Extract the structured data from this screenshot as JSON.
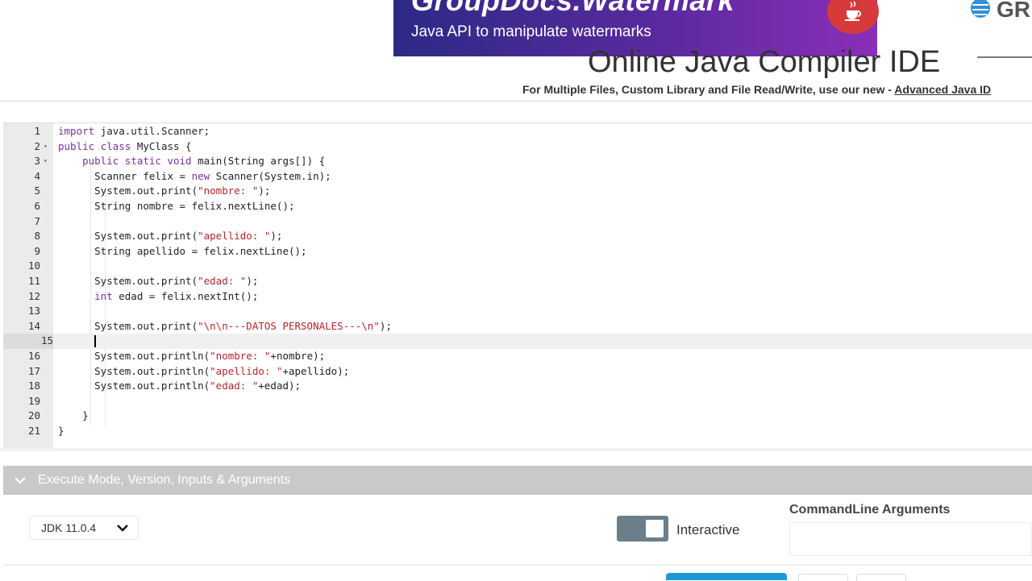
{
  "banner": {
    "title": "GroupDocs.Watermark",
    "subtitle": "Java API to manipulate watermarks",
    "icon": "java-cup-icon"
  },
  "brand_corner": {
    "text": "GR",
    "icon": "groupdocs-logo-icon"
  },
  "header": {
    "title": "Online Java Compiler IDE",
    "subtitle_prefix": "For Multiple Files, Custom Library and File Read/Write, use our new - ",
    "subtitle_link": "Advanced Java ID"
  },
  "editor": {
    "active_line": 15,
    "lines": [
      {
        "n": "1",
        "code": "import java.util.Scanner;"
      },
      {
        "n": "2",
        "code": "public class MyClass {"
      },
      {
        "n": "3",
        "code": "    public static void main(String args[]) {"
      },
      {
        "n": "4",
        "code": "      Scanner felix = new Scanner(System.in);"
      },
      {
        "n": "5",
        "code": "      System.out.print(\"nombre: \");"
      },
      {
        "n": "6",
        "code": "      String nombre = felix.nextLine();"
      },
      {
        "n": "7",
        "code": ""
      },
      {
        "n": "8",
        "code": "      System.out.print(\"apellido: \");"
      },
      {
        "n": "9",
        "code": "      String apellido = felix.nextLine();"
      },
      {
        "n": "10",
        "code": ""
      },
      {
        "n": "11",
        "code": "      System.out.print(\"edad: \");"
      },
      {
        "n": "12",
        "code": "      int edad = felix.nextInt();"
      },
      {
        "n": "13",
        "code": ""
      },
      {
        "n": "14",
        "code": "      System.out.print(\"\\n\\n---DATOS PERSONALES---\\n\");"
      },
      {
        "n": "15",
        "code": ""
      },
      {
        "n": "16",
        "code": "      System.out.println(\"nombre: \"+nombre);"
      },
      {
        "n": "17",
        "code": "      System.out.println(\"apellido: \"+apellido);"
      },
      {
        "n": "18",
        "code": "      System.out.println(\"edad: \"+edad);"
      },
      {
        "n": "19",
        "code": ""
      },
      {
        "n": "20",
        "code": "    }"
      },
      {
        "n": "21",
        "code": "}"
      }
    ]
  },
  "execute": {
    "section_label": "Execute Mode, Version, Inputs & Arguments",
    "jdk_value": "JDK 11.0.4",
    "interactive_label": "Interactive",
    "interactive_on": true,
    "cmd_label": "CommandLine Arguments",
    "cmd_value": ""
  },
  "colors": {
    "banner_start": "#2c2a86",
    "banner_end": "#8a2fb8",
    "keyword": "#7a2fa0",
    "string": "#b3262b",
    "toggle": "#6a7f8a",
    "execute_button": "#1d9ad6"
  }
}
